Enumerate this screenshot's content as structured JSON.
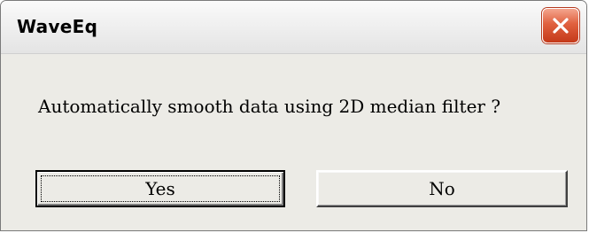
{
  "window": {
    "title": "WaveEq",
    "close_icon": "close-x-icon",
    "close_color": "#d9532f"
  },
  "dialog": {
    "message": "Automatically smooth data using 2D median filter ?",
    "buttons": {
      "yes_label": "Yes",
      "no_label": "No"
    },
    "default_button": "Yes"
  }
}
